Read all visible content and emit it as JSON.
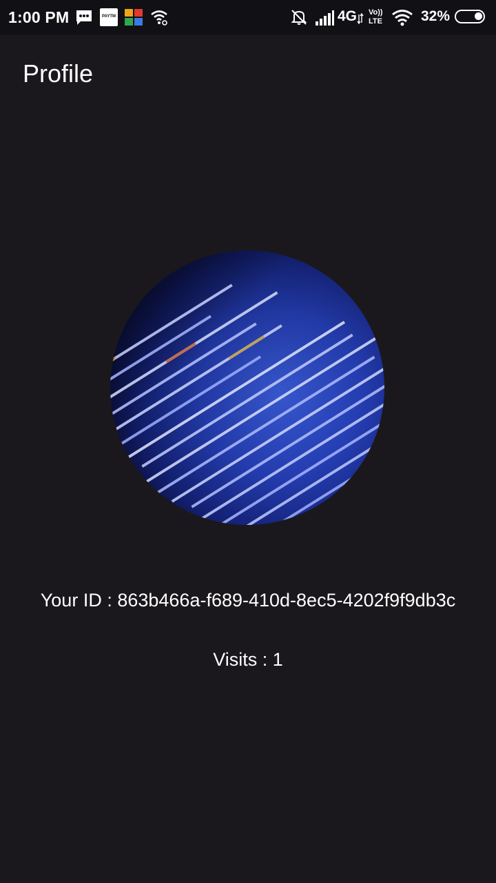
{
  "status_bar": {
    "time": "1:00 PM",
    "notification_icons": [
      "messages-icon",
      "paytm-icon",
      "app-grid-icon",
      "wifi-sync-icon"
    ],
    "paytm_label": "PAYTM",
    "network_label": "4G",
    "volte_top": "Vo))",
    "volte_bottom": "LTE",
    "battery_percent": "32%",
    "battery_level": 0.32
  },
  "app_bar": {
    "title": "Profile"
  },
  "profile": {
    "avatar": "code-screen-image",
    "id_line": "Your ID : 863b466a-f689-410d-8ec5-4202f9f9db3c",
    "visits_line": "Visits : 1"
  },
  "colors": {
    "background": "#1a181c",
    "status_bar": "#111014",
    "text": "#ffffff"
  }
}
